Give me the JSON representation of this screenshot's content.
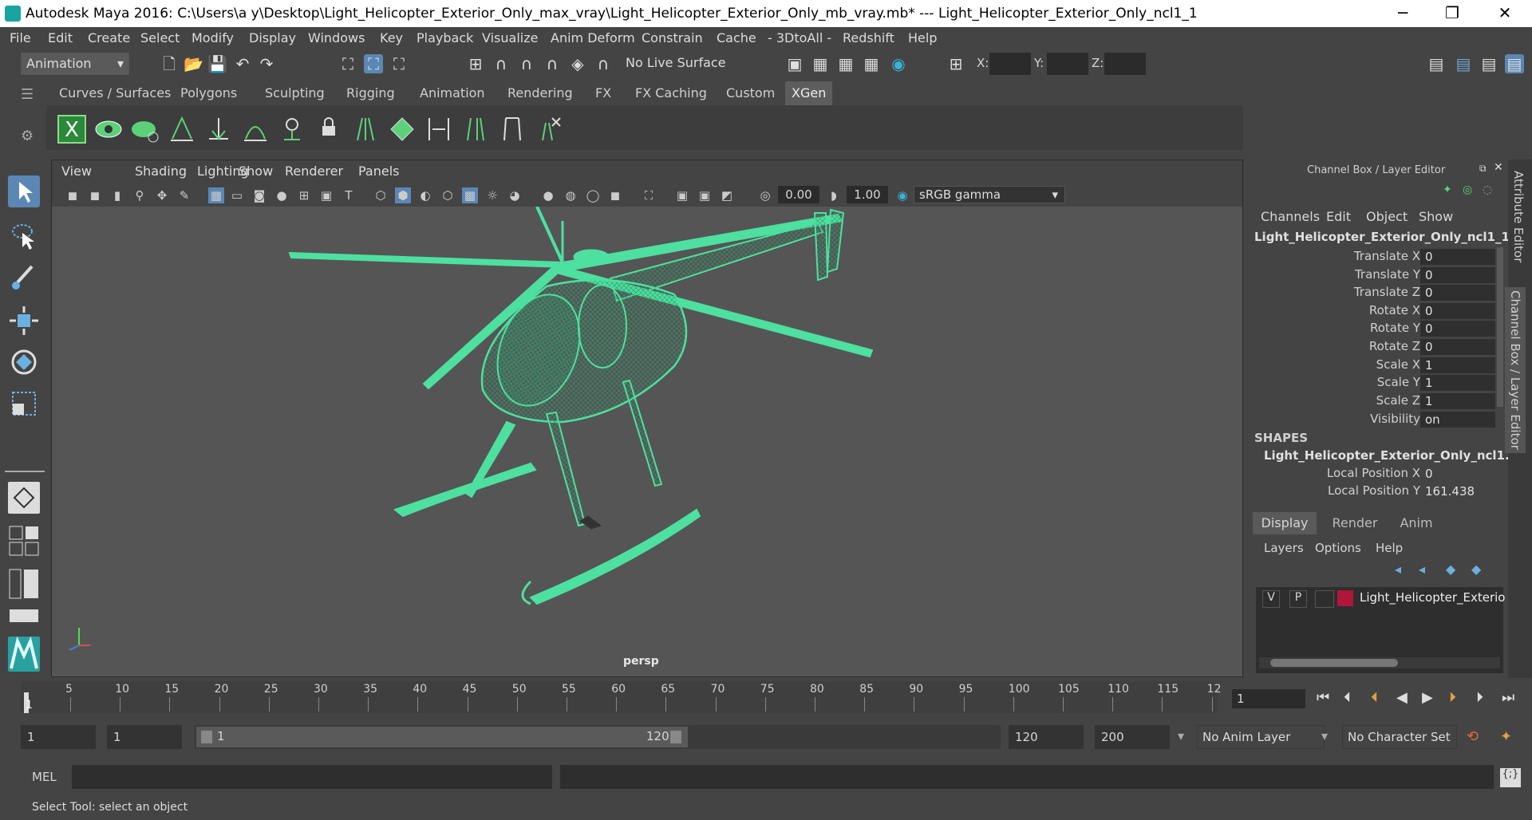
{
  "window": {
    "title": "Autodesk Maya 2016: C:\\Users\\a y\\Desktop\\Light_Helicopter_Exterior_Only_max_vray\\Light_Helicopter_Exterior_Only_mb_vray.mb*   ---   Light_Helicopter_Exterior_Only_ncl1_1",
    "minimize": "─",
    "maximize": "❐",
    "close": "✕"
  },
  "menubar": [
    "File",
    "Edit",
    "Create",
    "Select",
    "Modify",
    "Display",
    "Windows",
    "Key",
    "Playback",
    "Visualize",
    "Anim Deform",
    "Constrain",
    "Cache",
    "- 3DtoAll -",
    "Redshift",
    "Help"
  ],
  "statusline": {
    "mode": "Animation",
    "live_surface": "No Live Surface",
    "x_label": "X:",
    "y_label": "Y:",
    "z_label": "Z:"
  },
  "shelf_tabs": [
    "Curves / Surfaces",
    "Polygons",
    "Sculpting",
    "Rigging",
    "Animation",
    "Rendering",
    "FX",
    "FX Caching",
    "Custom",
    "XGen"
  ],
  "shelf_active": "XGen",
  "viewport": {
    "menu": [
      "View",
      "Shading",
      "Lighting",
      "Show",
      "Renderer",
      "Panels"
    ],
    "exposure": "0.00",
    "gamma": "1.00",
    "color_space": "sRGB gamma",
    "camera": "persp"
  },
  "channel_box": {
    "title": "Channel Box / Layer Editor",
    "menu": [
      "Channels",
      "Edit",
      "Object",
      "Show"
    ],
    "object_name": "Light_Helicopter_Exterior_Only_ncl1_1",
    "channels": [
      {
        "label": "Translate X",
        "value": "0"
      },
      {
        "label": "Translate Y",
        "value": "0"
      },
      {
        "label": "Translate Z",
        "value": "0"
      },
      {
        "label": "Rotate X",
        "value": "0"
      },
      {
        "label": "Rotate Y",
        "value": "0"
      },
      {
        "label": "Rotate Z",
        "value": "0"
      },
      {
        "label": "Scale X",
        "value": "1"
      },
      {
        "label": "Scale Y",
        "value": "1"
      },
      {
        "label": "Scale Z",
        "value": "1"
      },
      {
        "label": "Visibility",
        "value": "on"
      }
    ],
    "shapes_header": "SHAPES",
    "shape_name": "Light_Helicopter_Exterior_Only_ncl1...",
    "shape_channels": [
      {
        "label": "Local Position X",
        "value": "0"
      },
      {
        "label": "Local Position Y",
        "value": "161.438"
      }
    ]
  },
  "layer_editor": {
    "tabs": [
      "Display",
      "Render",
      "Anim"
    ],
    "active_tab": "Display",
    "menu": [
      "Layers",
      "Options",
      "Help"
    ],
    "layer": {
      "v": "V",
      "p": "P",
      "name": "Light_Helicopter_Exterio",
      "color": "#b0163a"
    }
  },
  "side_tabs": [
    "Attribute Editor",
    "Channel Box / Layer Editor"
  ],
  "timeline": {
    "ticks": [
      "5",
      "10",
      "15",
      "20",
      "25",
      "30",
      "35",
      "40",
      "45",
      "50",
      "55",
      "60",
      "65",
      "70",
      "75",
      "80",
      "85",
      "90",
      "95",
      "100",
      "105",
      "110",
      "115",
      "12"
    ],
    "current_frame_marker": "1",
    "current_frame": "1"
  },
  "range": {
    "start": "1",
    "playback_start": "1",
    "slider_start": "1",
    "slider_end": "120",
    "playback_end": "120",
    "end": "200",
    "anim_layer": "No Anim Layer",
    "character_set": "No Character Set"
  },
  "cmdline": {
    "label": "MEL"
  },
  "helpline": {
    "text": "Select Tool: select an object"
  },
  "colors": {
    "wireframe": "#4de0a0",
    "background": "#444444",
    "viewport": "#555555"
  }
}
